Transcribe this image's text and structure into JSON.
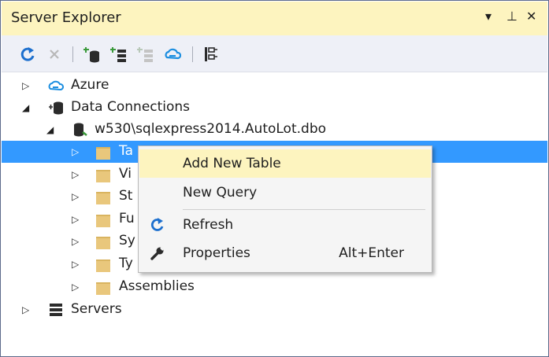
{
  "window": {
    "title": "Server Explorer"
  },
  "title_controls": {
    "dropdown": "▾",
    "pin": "⊥",
    "close": "✕"
  },
  "toolbar": {
    "buttons": [
      {
        "icon": "refresh-icon"
      },
      {
        "icon": "stop-icon"
      },
      {
        "icon": "connect-to-database-icon"
      },
      {
        "icon": "connect-to-server-icon"
      },
      {
        "icon": "add-sharepoint-connection-icon"
      },
      {
        "icon": "connect-to-azure-icon"
      },
      {
        "icon": "properties-window-icon"
      }
    ]
  },
  "tree": {
    "azure": "Azure",
    "data_connections": "Data Connections",
    "connection": "w530\\sqlexpress2014.AutoLot.dbo",
    "tables": "Ta",
    "views": "Vi",
    "stored_procedures": "St",
    "functions": "Fu",
    "synonyms": "Sy",
    "types": "Ty",
    "assemblies": "Assemblies",
    "servers": "Servers"
  },
  "context_menu": {
    "items": [
      {
        "label": "Add New Table",
        "highlighted": true
      },
      {
        "label": "New Query"
      },
      {
        "label": "Refresh",
        "icon": "refresh-icon"
      },
      {
        "label": "Properties",
        "icon": "wrench-icon",
        "shortcut": "Alt+Enter"
      }
    ]
  },
  "colors": {
    "titlebar": "#fdf4bf",
    "selection": "#3399ff",
    "menu_highlight": "#fdf4bf",
    "accent_blue": "#1c6fce"
  }
}
